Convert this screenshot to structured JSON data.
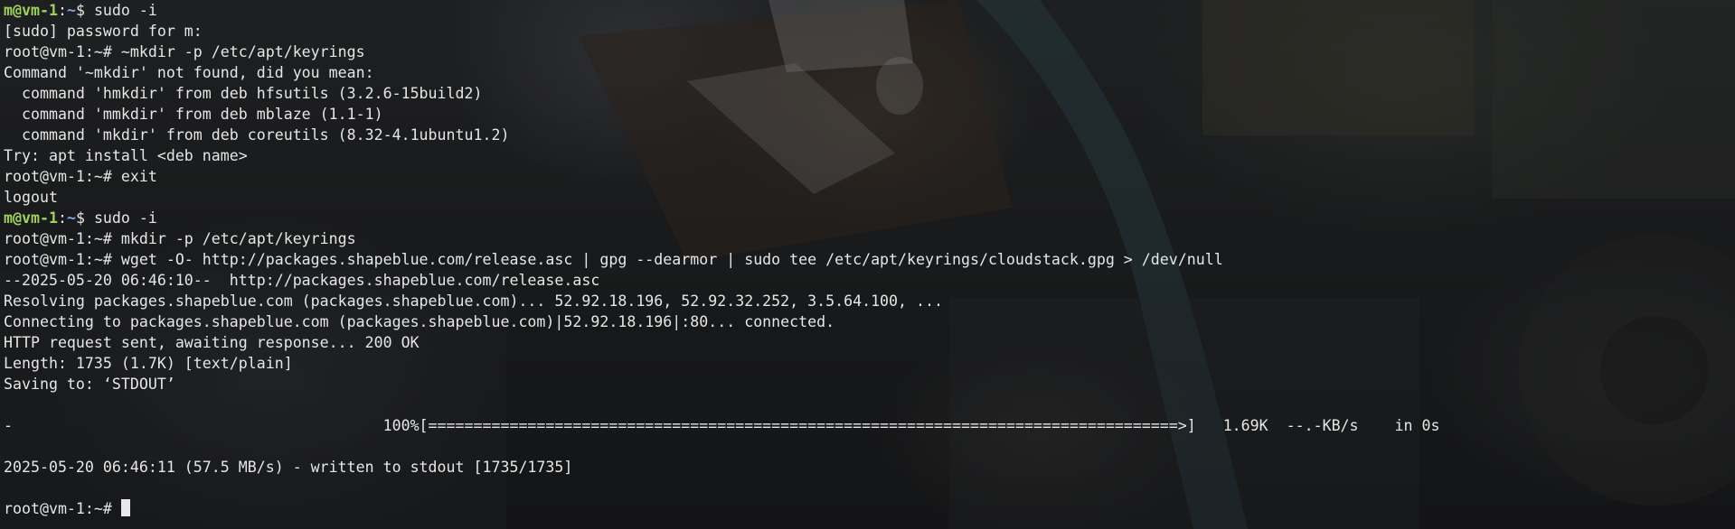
{
  "terminal": {
    "lines": [
      {
        "kind": "prompt",
        "user": "m@vm-1",
        "sep": ":",
        "path": "~",
        "sym": "$ ",
        "cmd": "sudo -i"
      },
      {
        "kind": "text",
        "text": "[sudo] password for m:"
      },
      {
        "kind": "text",
        "text": "root@vm-1:~# ~mkdir -p /etc/apt/keyrings"
      },
      {
        "kind": "text",
        "text": "Command '~mkdir' not found, did you mean:"
      },
      {
        "kind": "text",
        "text": "  command 'hmkdir' from deb hfsutils (3.2.6-15build2)"
      },
      {
        "kind": "text",
        "text": "  command 'mmkdir' from deb mblaze (1.1-1)"
      },
      {
        "kind": "text",
        "text": "  command 'mkdir' from deb coreutils (8.32-4.1ubuntu1.2)"
      },
      {
        "kind": "text",
        "text": "Try: apt install <deb name>"
      },
      {
        "kind": "text",
        "text": "root@vm-1:~# exit"
      },
      {
        "kind": "text",
        "text": "logout"
      },
      {
        "kind": "prompt",
        "user": "m@vm-1",
        "sep": ":",
        "path": "~",
        "sym": "$ ",
        "cmd": "sudo -i"
      },
      {
        "kind": "text",
        "text": "root@vm-1:~# mkdir -p /etc/apt/keyrings"
      },
      {
        "kind": "text",
        "text": "root@vm-1:~# wget -O- http://packages.shapeblue.com/release.asc | gpg --dearmor | sudo tee /etc/apt/keyrings/cloudstack.gpg > /dev/null"
      },
      {
        "kind": "text",
        "text": "--2025-05-20 06:46:10--  http://packages.shapeblue.com/release.asc"
      },
      {
        "kind": "text",
        "text": "Resolving packages.shapeblue.com (packages.shapeblue.com)... 52.92.18.196, 52.92.32.252, 3.5.64.100, ..."
      },
      {
        "kind": "text",
        "text": "Connecting to packages.shapeblue.com (packages.shapeblue.com)|52.92.18.196|:80... connected."
      },
      {
        "kind": "text",
        "text": "HTTP request sent, awaiting response... 200 OK"
      },
      {
        "kind": "text",
        "text": "Length: 1735 (1.7K) [text/plain]"
      },
      {
        "kind": "text",
        "text": "Saving to: ‘STDOUT’"
      },
      {
        "kind": "text",
        "text": ""
      },
      {
        "kind": "text",
        "text": "-                                         100%[===================================================================================>]   1.69K  --.-KB/s    in 0s"
      },
      {
        "kind": "text",
        "text": ""
      },
      {
        "kind": "text",
        "text": "2025-05-20 06:46:11 (57.5 MB/s) - written to stdout [1735/1735]"
      },
      {
        "kind": "text",
        "text": ""
      },
      {
        "kind": "text",
        "text": "root@vm-1:~# ",
        "cursor": true
      }
    ]
  },
  "colors": {
    "prompt_user": "#9fd15a",
    "prompt_path": "#7fa7e8",
    "text": "#e6e6e6",
    "background": "#1d1f22"
  }
}
